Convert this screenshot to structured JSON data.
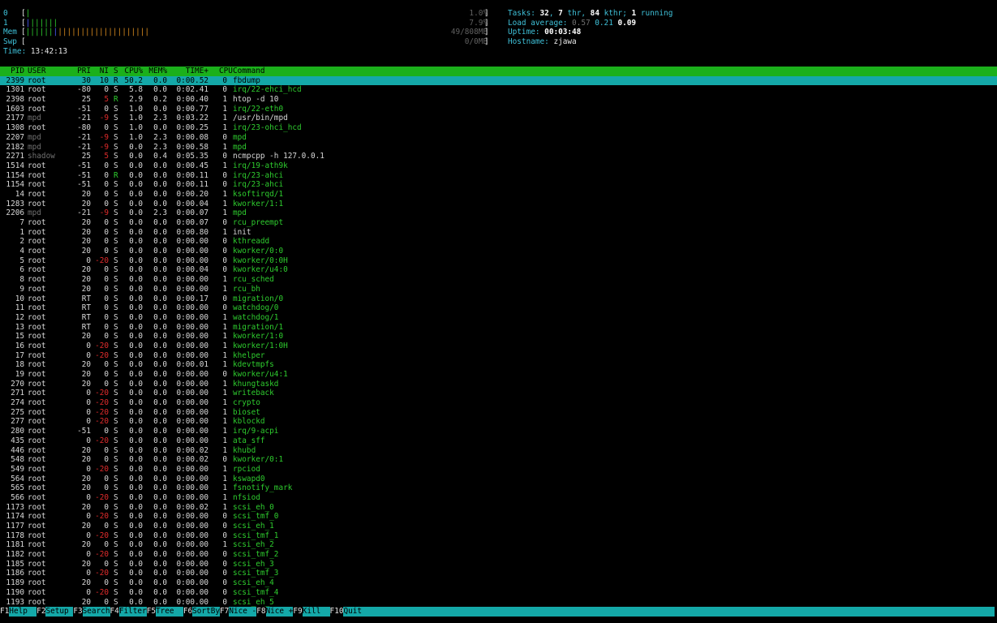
{
  "meters": [
    {
      "label": "0",
      "bars": [
        {
          "c": "green",
          "t": "|"
        }
      ],
      "pct": "1.0%"
    },
    {
      "label": "1",
      "bars": [
        {
          "c": "blue",
          "t": "|"
        },
        {
          "c": "green",
          "t": "||||||"
        }
      ],
      "pct": "7.9%"
    },
    {
      "label": "Mem",
      "bars": [
        {
          "c": "green",
          "t": "||||||"
        },
        {
          "c": "blue",
          "t": "|"
        },
        {
          "c": "orange",
          "t": "||||||||||||||||||||"
        }
      ],
      "pct": "49/808MB"
    },
    {
      "label": "Swp",
      "bars": [],
      "pct": "0/0MB"
    }
  ],
  "time": {
    "label": "Time:",
    "value": "13:42:13"
  },
  "info": {
    "tasks_label": "Tasks:",
    "tasks": "32",
    "thr": "7",
    "thr_label": "thr,",
    "kthr": "84",
    "kthr_label": "kthr;",
    "running": "1",
    "running_label": "running",
    "load_label": "Load average:",
    "load1": "0.57",
    "load5": "0.21",
    "load15": "0.09",
    "uptime_label": "Uptime:",
    "uptime": "00:03:48",
    "hostname_label": "Hostname:",
    "hostname": "zjawa"
  },
  "columns": {
    "pid": "PID",
    "user": "USER",
    "pri": "PRI",
    "ni": "NI",
    "s": "S",
    "cpu": "CPU%",
    "mem": "MEM%",
    "time": "TIME+",
    "cpun": "CPU",
    "cmd": "Command"
  },
  "processes": [
    {
      "pid": "2399",
      "user": "root",
      "pri": "30",
      "ni": "10",
      "s": "R",
      "cpu": "50.2",
      "mem": "0.0",
      "time": "0:00.52",
      "cpun": "0",
      "cmd": "fbdump",
      "sel": true
    },
    {
      "pid": "1301",
      "user": "root",
      "pri": "-80",
      "ni": "0",
      "s": "S",
      "cpu": "5.8",
      "mem": "0.0",
      "time": "0:02.41",
      "cpun": "0",
      "cmd": "irq/22-ehci_hcd",
      "k": true
    },
    {
      "pid": "2398",
      "user": "root",
      "pri": "25",
      "ni": "5",
      "s": "R",
      "cpu": "2.9",
      "mem": "0.2",
      "time": "0:00.40",
      "cpun": "1",
      "cmd": "htop -d 10",
      "nired": true
    },
    {
      "pid": "1603",
      "user": "root",
      "pri": "-51",
      "ni": "0",
      "s": "S",
      "cpu": "1.0",
      "mem": "0.0",
      "time": "0:00.77",
      "cpun": "1",
      "cmd": "irq/22-eth0",
      "k": true
    },
    {
      "pid": "2177",
      "user": "mpd",
      "pri": "-21",
      "ni": "-9",
      "s": "S",
      "cpu": "1.0",
      "mem": "2.3",
      "time": "0:03.22",
      "cpun": "1",
      "cmd": "/usr/bin/mpd",
      "nired": true,
      "dim": true
    },
    {
      "pid": "1308",
      "user": "root",
      "pri": "-80",
      "ni": "0",
      "s": "S",
      "cpu": "1.0",
      "mem": "0.0",
      "time": "0:00.25",
      "cpun": "1",
      "cmd": "irq/23-ohci_hcd",
      "k": true
    },
    {
      "pid": "2207",
      "user": "mpd",
      "pri": "-21",
      "ni": "-9",
      "s": "S",
      "cpu": "1.0",
      "mem": "2.3",
      "time": "0:00.08",
      "cpun": "0",
      "cmd": "mpd",
      "nired": true,
      "dim": true,
      "k": true
    },
    {
      "pid": "2182",
      "user": "mpd",
      "pri": "-21",
      "ni": "-9",
      "s": "S",
      "cpu": "0.0",
      "mem": "2.3",
      "time": "0:00.58",
      "cpun": "1",
      "cmd": "mpd",
      "nired": true,
      "dim": true,
      "k": true
    },
    {
      "pid": "2271",
      "user": "shadow",
      "pri": "25",
      "ni": "5",
      "s": "S",
      "cpu": "0.0",
      "mem": "0.4",
      "time": "0:05.35",
      "cpun": "0",
      "cmd": "ncmpcpp -h 127.0.0.1",
      "nired": true,
      "dim": true
    },
    {
      "pid": "1514",
      "user": "root",
      "pri": "-51",
      "ni": "0",
      "s": "S",
      "cpu": "0.0",
      "mem": "0.0",
      "time": "0:00.45",
      "cpun": "1",
      "cmd": "irq/19-ath9k",
      "k": true
    },
    {
      "pid": "1154",
      "user": "root",
      "pri": "-51",
      "ni": "0",
      "s": "R",
      "cpu": "0.0",
      "mem": "0.0",
      "time": "0:00.11",
      "cpun": "0",
      "cmd": "irq/23-ahci",
      "k": true
    },
    {
      "pid": "1154",
      "user": "root",
      "pri": "-51",
      "ni": "0",
      "s": "S",
      "cpu": "0.0",
      "mem": "0.0",
      "time": "0:00.11",
      "cpun": "0",
      "cmd": "irq/23-ahci",
      "k": true
    },
    {
      "pid": "14",
      "user": "root",
      "pri": "20",
      "ni": "0",
      "s": "S",
      "cpu": "0.0",
      "mem": "0.0",
      "time": "0:00.20",
      "cpun": "1",
      "cmd": "ksoftirqd/1",
      "k": true
    },
    {
      "pid": "1283",
      "user": "root",
      "pri": "20",
      "ni": "0",
      "s": "S",
      "cpu": "0.0",
      "mem": "0.0",
      "time": "0:00.04",
      "cpun": "1",
      "cmd": "kworker/1:1",
      "k": true
    },
    {
      "pid": "2206",
      "user": "mpd",
      "pri": "-21",
      "ni": "-9",
      "s": "S",
      "cpu": "0.0",
      "mem": "2.3",
      "time": "0:00.07",
      "cpun": "1",
      "cmd": "mpd",
      "nired": true,
      "dim": true,
      "k": true
    },
    {
      "pid": "7",
      "user": "root",
      "pri": "20",
      "ni": "0",
      "s": "S",
      "cpu": "0.0",
      "mem": "0.0",
      "time": "0:00.07",
      "cpun": "0",
      "cmd": "rcu_preempt",
      "k": true
    },
    {
      "pid": "1",
      "user": "root",
      "pri": "20",
      "ni": "0",
      "s": "S",
      "cpu": "0.0",
      "mem": "0.0",
      "time": "0:00.80",
      "cpun": "1",
      "cmd": "init"
    },
    {
      "pid": "2",
      "user": "root",
      "pri": "20",
      "ni": "0",
      "s": "S",
      "cpu": "0.0",
      "mem": "0.0",
      "time": "0:00.00",
      "cpun": "0",
      "cmd": "kthreadd",
      "k": true
    },
    {
      "pid": "4",
      "user": "root",
      "pri": "20",
      "ni": "0",
      "s": "S",
      "cpu": "0.0",
      "mem": "0.0",
      "time": "0:00.00",
      "cpun": "0",
      "cmd": "kworker/0:0",
      "k": true
    },
    {
      "pid": "5",
      "user": "root",
      "pri": "0",
      "ni": "-20",
      "s": "S",
      "cpu": "0.0",
      "mem": "0.0",
      "time": "0:00.00",
      "cpun": "0",
      "cmd": "kworker/0:0H",
      "nired": true,
      "k": true
    },
    {
      "pid": "6",
      "user": "root",
      "pri": "20",
      "ni": "0",
      "s": "S",
      "cpu": "0.0",
      "mem": "0.0",
      "time": "0:00.04",
      "cpun": "0",
      "cmd": "kworker/u4:0",
      "k": true
    },
    {
      "pid": "8",
      "user": "root",
      "pri": "20",
      "ni": "0",
      "s": "S",
      "cpu": "0.0",
      "mem": "0.0",
      "time": "0:00.00",
      "cpun": "1",
      "cmd": "rcu_sched",
      "k": true
    },
    {
      "pid": "9",
      "user": "root",
      "pri": "20",
      "ni": "0",
      "s": "S",
      "cpu": "0.0",
      "mem": "0.0",
      "time": "0:00.00",
      "cpun": "1",
      "cmd": "rcu_bh",
      "k": true
    },
    {
      "pid": "10",
      "user": "root",
      "pri": "RT",
      "ni": "0",
      "s": "S",
      "cpu": "0.0",
      "mem": "0.0",
      "time": "0:00.17",
      "cpun": "0",
      "cmd": "migration/0",
      "k": true
    },
    {
      "pid": "11",
      "user": "root",
      "pri": "RT",
      "ni": "0",
      "s": "S",
      "cpu": "0.0",
      "mem": "0.0",
      "time": "0:00.00",
      "cpun": "0",
      "cmd": "watchdog/0",
      "k": true
    },
    {
      "pid": "12",
      "user": "root",
      "pri": "RT",
      "ni": "0",
      "s": "S",
      "cpu": "0.0",
      "mem": "0.0",
      "time": "0:00.00",
      "cpun": "1",
      "cmd": "watchdog/1",
      "k": true
    },
    {
      "pid": "13",
      "user": "root",
      "pri": "RT",
      "ni": "0",
      "s": "S",
      "cpu": "0.0",
      "mem": "0.0",
      "time": "0:00.00",
      "cpun": "1",
      "cmd": "migration/1",
      "k": true
    },
    {
      "pid": "15",
      "user": "root",
      "pri": "20",
      "ni": "0",
      "s": "S",
      "cpu": "0.0",
      "mem": "0.0",
      "time": "0:00.00",
      "cpun": "1",
      "cmd": "kworker/1:0",
      "k": true
    },
    {
      "pid": "16",
      "user": "root",
      "pri": "0",
      "ni": "-20",
      "s": "S",
      "cpu": "0.0",
      "mem": "0.0",
      "time": "0:00.00",
      "cpun": "1",
      "cmd": "kworker/1:0H",
      "nired": true,
      "k": true
    },
    {
      "pid": "17",
      "user": "root",
      "pri": "0",
      "ni": "-20",
      "s": "S",
      "cpu": "0.0",
      "mem": "0.0",
      "time": "0:00.00",
      "cpun": "1",
      "cmd": "khelper",
      "nired": true,
      "k": true
    },
    {
      "pid": "18",
      "user": "root",
      "pri": "20",
      "ni": "0",
      "s": "S",
      "cpu": "0.0",
      "mem": "0.0",
      "time": "0:00.01",
      "cpun": "1",
      "cmd": "kdevtmpfs",
      "k": true
    },
    {
      "pid": "19",
      "user": "root",
      "pri": "20",
      "ni": "0",
      "s": "S",
      "cpu": "0.0",
      "mem": "0.0",
      "time": "0:00.00",
      "cpun": "0",
      "cmd": "kworker/u4:1",
      "k": true
    },
    {
      "pid": "270",
      "user": "root",
      "pri": "20",
      "ni": "0",
      "s": "S",
      "cpu": "0.0",
      "mem": "0.0",
      "time": "0:00.00",
      "cpun": "1",
      "cmd": "khungtaskd",
      "k": true
    },
    {
      "pid": "271",
      "user": "root",
      "pri": "0",
      "ni": "-20",
      "s": "S",
      "cpu": "0.0",
      "mem": "0.0",
      "time": "0:00.00",
      "cpun": "1",
      "cmd": "writeback",
      "nired": true,
      "k": true
    },
    {
      "pid": "274",
      "user": "root",
      "pri": "0",
      "ni": "-20",
      "s": "S",
      "cpu": "0.0",
      "mem": "0.0",
      "time": "0:00.00",
      "cpun": "1",
      "cmd": "crypto",
      "nired": true,
      "k": true
    },
    {
      "pid": "275",
      "user": "root",
      "pri": "0",
      "ni": "-20",
      "s": "S",
      "cpu": "0.0",
      "mem": "0.0",
      "time": "0:00.00",
      "cpun": "1",
      "cmd": "bioset",
      "nired": true,
      "k": true
    },
    {
      "pid": "277",
      "user": "root",
      "pri": "0",
      "ni": "-20",
      "s": "S",
      "cpu": "0.0",
      "mem": "0.0",
      "time": "0:00.00",
      "cpun": "1",
      "cmd": "kblockd",
      "nired": true,
      "k": true
    },
    {
      "pid": "280",
      "user": "root",
      "pri": "-51",
      "ni": "0",
      "s": "S",
      "cpu": "0.0",
      "mem": "0.0",
      "time": "0:00.00",
      "cpun": "1",
      "cmd": "irq/9-acpi",
      "k": true
    },
    {
      "pid": "435",
      "user": "root",
      "pri": "0",
      "ni": "-20",
      "s": "S",
      "cpu": "0.0",
      "mem": "0.0",
      "time": "0:00.00",
      "cpun": "1",
      "cmd": "ata_sff",
      "nired": true,
      "k": true
    },
    {
      "pid": "446",
      "user": "root",
      "pri": "20",
      "ni": "0",
      "s": "S",
      "cpu": "0.0",
      "mem": "0.0",
      "time": "0:00.02",
      "cpun": "1",
      "cmd": "khubd",
      "k": true
    },
    {
      "pid": "548",
      "user": "root",
      "pri": "20",
      "ni": "0",
      "s": "S",
      "cpu": "0.0",
      "mem": "0.0",
      "time": "0:00.02",
      "cpun": "0",
      "cmd": "kworker/0:1",
      "k": true
    },
    {
      "pid": "549",
      "user": "root",
      "pri": "0",
      "ni": "-20",
      "s": "S",
      "cpu": "0.0",
      "mem": "0.0",
      "time": "0:00.00",
      "cpun": "1",
      "cmd": "rpciod",
      "nired": true,
      "k": true
    },
    {
      "pid": "564",
      "user": "root",
      "pri": "20",
      "ni": "0",
      "s": "S",
      "cpu": "0.0",
      "mem": "0.0",
      "time": "0:00.00",
      "cpun": "1",
      "cmd": "kswapd0",
      "k": true
    },
    {
      "pid": "565",
      "user": "root",
      "pri": "20",
      "ni": "0",
      "s": "S",
      "cpu": "0.0",
      "mem": "0.0",
      "time": "0:00.00",
      "cpun": "1",
      "cmd": "fsnotify_mark",
      "k": true
    },
    {
      "pid": "566",
      "user": "root",
      "pri": "0",
      "ni": "-20",
      "s": "S",
      "cpu": "0.0",
      "mem": "0.0",
      "time": "0:00.00",
      "cpun": "1",
      "cmd": "nfsiod",
      "nired": true,
      "k": true
    },
    {
      "pid": "1173",
      "user": "root",
      "pri": "20",
      "ni": "0",
      "s": "S",
      "cpu": "0.0",
      "mem": "0.0",
      "time": "0:00.02",
      "cpun": "1",
      "cmd": "scsi_eh_0",
      "k": true
    },
    {
      "pid": "1174",
      "user": "root",
      "pri": "0",
      "ni": "-20",
      "s": "S",
      "cpu": "0.0",
      "mem": "0.0",
      "time": "0:00.00",
      "cpun": "0",
      "cmd": "scsi_tmf_0",
      "nired": true,
      "k": true
    },
    {
      "pid": "1177",
      "user": "root",
      "pri": "20",
      "ni": "0",
      "s": "S",
      "cpu": "0.0",
      "mem": "0.0",
      "time": "0:00.00",
      "cpun": "0",
      "cmd": "scsi_eh_1",
      "k": true
    },
    {
      "pid": "1178",
      "user": "root",
      "pri": "0",
      "ni": "-20",
      "s": "S",
      "cpu": "0.0",
      "mem": "0.0",
      "time": "0:00.00",
      "cpun": "0",
      "cmd": "scsi_tmf_1",
      "nired": true,
      "k": true
    },
    {
      "pid": "1181",
      "user": "root",
      "pri": "20",
      "ni": "0",
      "s": "S",
      "cpu": "0.0",
      "mem": "0.0",
      "time": "0:00.00",
      "cpun": "1",
      "cmd": "scsi_eh_2",
      "k": true
    },
    {
      "pid": "1182",
      "user": "root",
      "pri": "0",
      "ni": "-20",
      "s": "S",
      "cpu": "0.0",
      "mem": "0.0",
      "time": "0:00.00",
      "cpun": "0",
      "cmd": "scsi_tmf_2",
      "nired": true,
      "k": true
    },
    {
      "pid": "1185",
      "user": "root",
      "pri": "20",
      "ni": "0",
      "s": "S",
      "cpu": "0.0",
      "mem": "0.0",
      "time": "0:00.00",
      "cpun": "0",
      "cmd": "scsi_eh_3",
      "k": true
    },
    {
      "pid": "1186",
      "user": "root",
      "pri": "0",
      "ni": "-20",
      "s": "S",
      "cpu": "0.0",
      "mem": "0.0",
      "time": "0:00.00",
      "cpun": "0",
      "cmd": "scsi_tmf_3",
      "nired": true,
      "k": true
    },
    {
      "pid": "1189",
      "user": "root",
      "pri": "20",
      "ni": "0",
      "s": "S",
      "cpu": "0.0",
      "mem": "0.0",
      "time": "0:00.00",
      "cpun": "0",
      "cmd": "scsi_eh_4",
      "k": true
    },
    {
      "pid": "1190",
      "user": "root",
      "pri": "0",
      "ni": "-20",
      "s": "S",
      "cpu": "0.0",
      "mem": "0.0",
      "time": "0:00.00",
      "cpun": "0",
      "cmd": "scsi_tmf_4",
      "nired": true,
      "k": true
    },
    {
      "pid": "1193",
      "user": "root",
      "pri": "20",
      "ni": "0",
      "s": "S",
      "cpu": "0.0",
      "mem": "0.0",
      "time": "0:00.00",
      "cpun": "0",
      "cmd": "scsi_eh_5",
      "k": true
    }
  ],
  "footer": [
    {
      "key": "F1",
      "label": "Help  "
    },
    {
      "key": "F2",
      "label": "Setup "
    },
    {
      "key": "F3",
      "label": "Search"
    },
    {
      "key": "F4",
      "label": "Filter"
    },
    {
      "key": "F5",
      "label": "Tree  "
    },
    {
      "key": "F6",
      "label": "SortBy"
    },
    {
      "key": "F7",
      "label": "Nice -"
    },
    {
      "key": "F8",
      "label": "Nice +"
    },
    {
      "key": "F9",
      "label": "Kill  "
    },
    {
      "key": "F10",
      "label": "Quit"
    }
  ],
  "colors": {
    "header_bar": "#1bb01b",
    "selection": "#14a8a8",
    "kernel_thread": "#2ecc2e",
    "negative_nice": "#e02b2b",
    "label_cyan": "#3fc0d8"
  }
}
